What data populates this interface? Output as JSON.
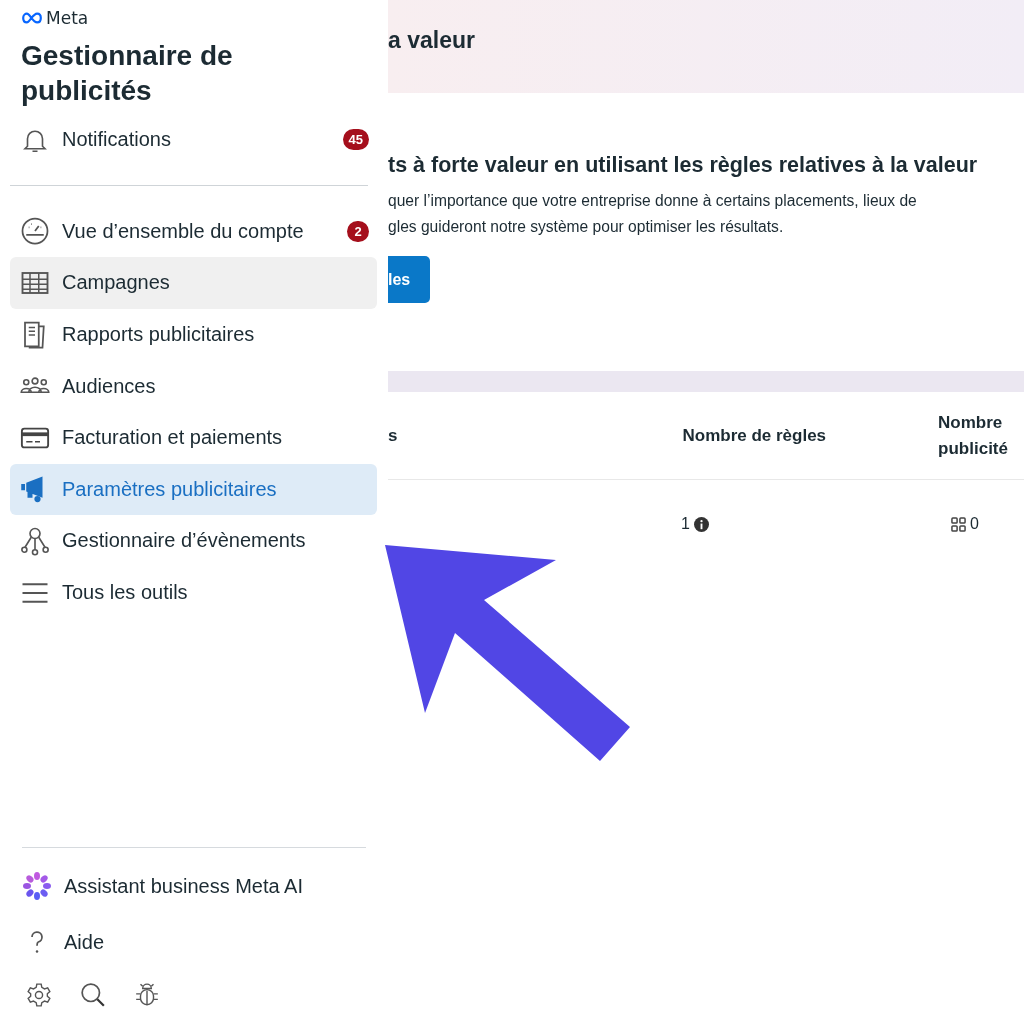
{
  "sidebar": {
    "brand": "Meta",
    "title": "Gestionnaire de publicités",
    "notifications": {
      "label": "Notifications",
      "badge": "45",
      "kind": "bell"
    },
    "items": [
      {
        "label": "Vue d’ensemble du compte",
        "kind": "gauge",
        "badge": "2",
        "selected": false,
        "hovered": false
      },
      {
        "label": "Campagnes",
        "kind": "table",
        "selected": false,
        "hovered": true
      },
      {
        "label": "Rapports publicitaires",
        "kind": "report",
        "selected": false,
        "hovered": false
      },
      {
        "label": "Audiences",
        "kind": "people",
        "selected": false,
        "hovered": false
      },
      {
        "label": "Facturation et paiements",
        "kind": "card",
        "selected": false,
        "hovered": false
      },
      {
        "label": "Paramètres publicitaires",
        "kind": "megaphone",
        "selected": true,
        "hovered": false
      },
      {
        "label": "Gestionnaire d’évènements",
        "kind": "nodes",
        "selected": false,
        "hovered": false
      },
      {
        "label": "Tous les outils",
        "kind": "menu",
        "selected": false,
        "hovered": false
      }
    ],
    "footer_items": [
      {
        "label": "Assistant business Meta AI",
        "kind": "ai"
      },
      {
        "label": "Aide",
        "kind": "help"
      }
    ]
  },
  "main": {
    "page_title": "a valeur",
    "section_heading": "ts à forte valeur en utilisant les règles relatives à la valeur",
    "description_lines": [
      "quer l’importance que votre entreprise donne à certains placements, lieux de",
      "gles guideront notre système pour optimiser les résultats."
    ],
    "button": "les",
    "table": {
      "columns": [
        "s",
        "Nombre de règles",
        [
          "Nombre",
          "publicité"
        ]
      ],
      "rows": [
        {
          "rules": "1",
          "ads": "0"
        }
      ]
    }
  },
  "annotation": {
    "kind": "arrow",
    "color": "#5146e5"
  }
}
